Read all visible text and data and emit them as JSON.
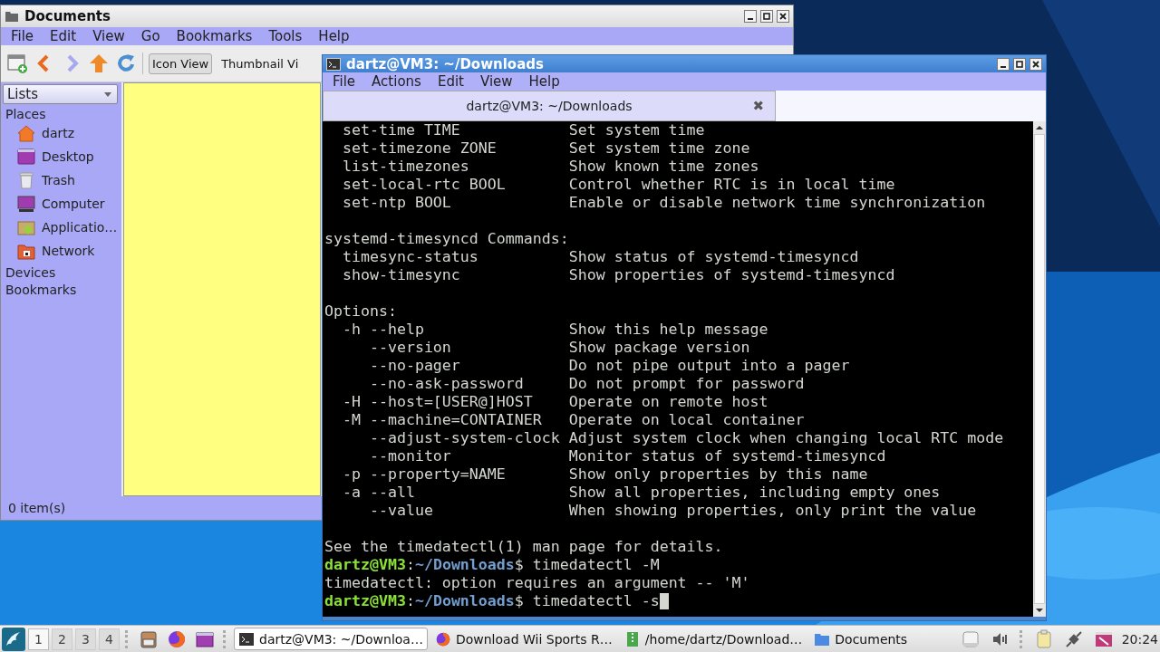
{
  "file_manager": {
    "title": "Documents",
    "menu": [
      "File",
      "Edit",
      "View",
      "Go",
      "Bookmarks",
      "Tools",
      "Help"
    ],
    "views": [
      {
        "label": "Icon View",
        "selected": true
      },
      {
        "label": "Thumbnail Vi",
        "selected": false
      }
    ],
    "side_pane": {
      "mode": "Lists",
      "sections": [
        {
          "label": "Places",
          "items": [
            "dartz",
            "Desktop",
            "Trash",
            "Computer",
            "Applicatio…",
            "Network"
          ]
        },
        {
          "label": "Devices"
        },
        {
          "label": "Bookmarks"
        }
      ]
    },
    "status": "0 item(s)"
  },
  "terminal": {
    "title": "dartz@VM3: ~/Downloads",
    "menu": [
      "File",
      "Actions",
      "Edit",
      "View",
      "Help"
    ],
    "tab": {
      "label": "dartz@VM3: ~/Downloads",
      "close": "✖"
    },
    "lines": [
      {
        "kind": "option",
        "option": "set-time TIME",
        "description": "Set system time"
      },
      {
        "kind": "option",
        "option": "set-timezone ZONE",
        "description": "Set system time zone"
      },
      {
        "kind": "option",
        "option": "list-timezones",
        "description": "Show known time zones"
      },
      {
        "kind": "option",
        "option": "set-local-rtc BOOL",
        "description": "Control whether RTC is in local time"
      },
      {
        "kind": "option",
        "option": "set-ntp BOOL",
        "description": "Enable or disable network time synchronization"
      },
      {
        "kind": "blank"
      },
      {
        "kind": "text",
        "text": "systemd-timesyncd Commands:"
      },
      {
        "kind": "option",
        "option": "timesync-status",
        "description": "Show status of systemd-timesyncd"
      },
      {
        "kind": "option",
        "option": "show-timesync",
        "description": "Show properties of systemd-timesyncd"
      },
      {
        "kind": "blank"
      },
      {
        "kind": "text",
        "text": "Options:"
      },
      {
        "kind": "option",
        "option": "-h --help",
        "description": "Show this help message"
      },
      {
        "kind": "suboption",
        "option": "--version",
        "description": "Show package version"
      },
      {
        "kind": "suboption",
        "option": "--no-pager",
        "description": "Do not pipe output into a pager"
      },
      {
        "kind": "suboption",
        "option": "--no-ask-password",
        "description": "Do not prompt for password"
      },
      {
        "kind": "option",
        "option": "-H --host=[USER@]HOST",
        "description": "Operate on remote host"
      },
      {
        "kind": "option",
        "option": "-M --machine=CONTAINER",
        "description": "Operate on local container"
      },
      {
        "kind": "suboption",
        "option": "--adjust-system-clock",
        "description": "Adjust system clock when changing local RTC mode"
      },
      {
        "kind": "suboption",
        "option": "--monitor",
        "description": "Monitor status of systemd-timesyncd"
      },
      {
        "kind": "option",
        "option": "-p --property=NAME",
        "description": "Show only properties by this name"
      },
      {
        "kind": "option",
        "option": "-a --all",
        "description": "Show all properties, including empty ones"
      },
      {
        "kind": "suboption",
        "option": "--value",
        "description": "When showing properties, only print the value"
      },
      {
        "kind": "blank"
      },
      {
        "kind": "text",
        "text": "See the timedatectl(1) man page for details."
      },
      {
        "kind": "prompt",
        "user": "dartz@VM3",
        "separator": ":",
        "path": "~/Downloads",
        "symbol": "$",
        "command": "timedatectl -M",
        "cursor": false
      },
      {
        "kind": "text",
        "text": "timedatectl: option requires an argument -- 'M'"
      },
      {
        "kind": "prompt",
        "user": "dartz@VM3",
        "separator": ":",
        "path": "~/Downloads",
        "symbol": "$",
        "command": "timedatectl -s",
        "cursor": true
      }
    ]
  },
  "taskbar": {
    "desktops": [
      {
        "label": "1",
        "selected": true
      },
      {
        "label": "2",
        "selected": false
      },
      {
        "label": "3",
        "selected": false
      },
      {
        "label": "4",
        "selected": false
      }
    ],
    "tasks": [
      {
        "label": "dartz@VM3: ~/Downloa…",
        "selected": true
      },
      {
        "label": "Download Wii Sports R…",
        "selected": false
      },
      {
        "label": "/home/dartz/Download…",
        "selected": false
      },
      {
        "label": "Documents",
        "selected": false
      }
    ],
    "clock": "20:24"
  }
}
